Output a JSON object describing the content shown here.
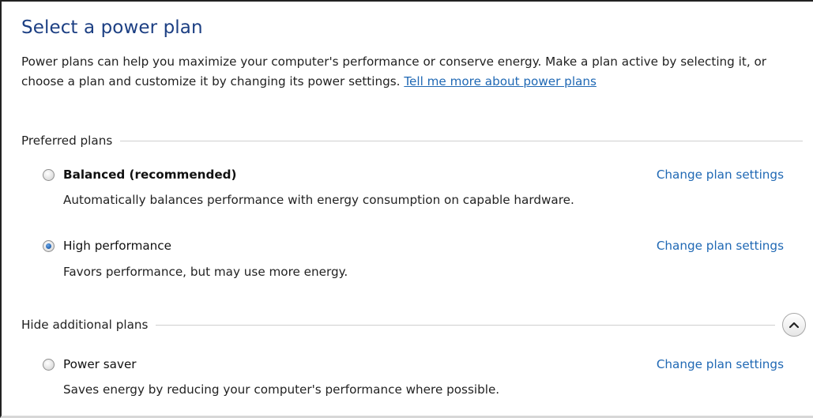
{
  "page": {
    "title": "Select a power plan",
    "intro_text": "Power plans can help you maximize your computer's performance or conserve energy. Make a plan active by selecting it, or choose a plan and customize it by changing its power settings. ",
    "intro_link": "Tell me more about power plans"
  },
  "preferred": {
    "label": "Preferred plans",
    "plans": [
      {
        "name": "Balanced (recommended)",
        "description": "Automatically balances performance with energy consumption on capable hardware.",
        "link": "Change plan settings",
        "selected": false
      },
      {
        "name": "High performance",
        "description": "Favors performance, but may use more energy.",
        "link": "Change plan settings",
        "selected": true
      }
    ]
  },
  "additional": {
    "label": "Hide additional plans",
    "toggle_icon": "chevron-up-icon",
    "plans": [
      {
        "name": "Power saver",
        "description": "Saves energy by reducing your computer's performance where possible.",
        "link": "Change plan settings",
        "selected": false
      }
    ]
  },
  "colors": {
    "title": "#1c3f83",
    "link": "#1f68b4",
    "radio_selected": "#1f5fae"
  }
}
